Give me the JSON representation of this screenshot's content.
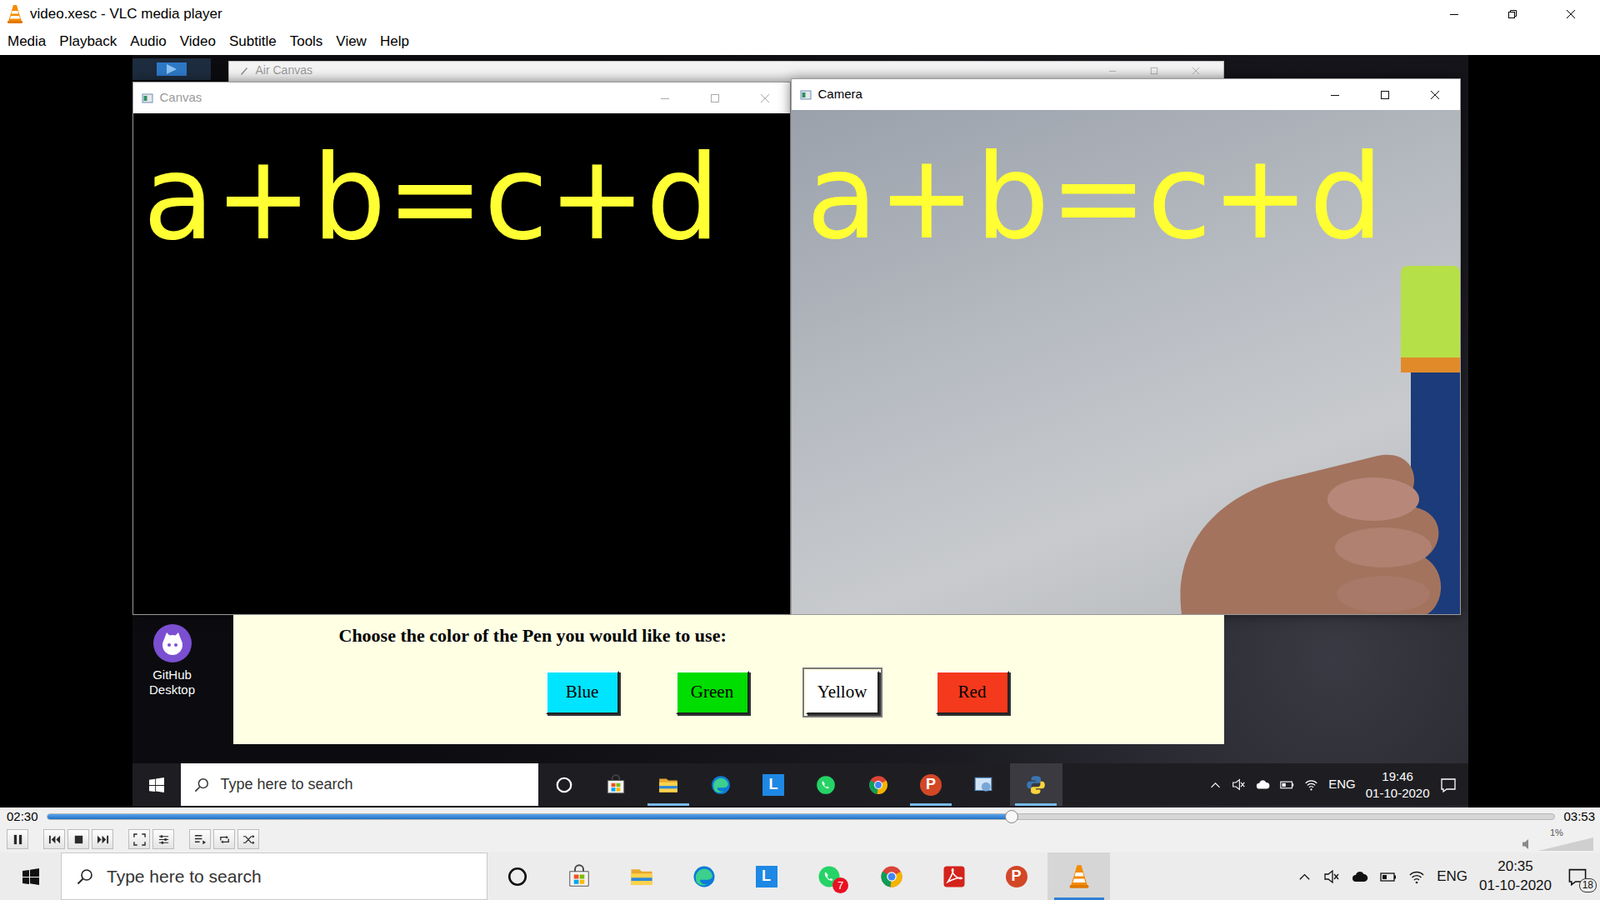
{
  "window": {
    "title": "video.xesc - VLC media player"
  },
  "menu": [
    {
      "label": "Media"
    },
    {
      "label": "Playback"
    },
    {
      "label": "Audio"
    },
    {
      "label": "Video"
    },
    {
      "label": "Subtitle"
    },
    {
      "label": "Tools"
    },
    {
      "label": "View"
    },
    {
      "label": "Help"
    }
  ],
  "video": {
    "back_window": {
      "title": "Air Canvas"
    },
    "canvas_window": {
      "title": "Canvas",
      "active": false,
      "drawing": "a+b=c+d"
    },
    "camera_window": {
      "title": "Camera",
      "active": true,
      "overlay": "a+b=c+d"
    },
    "pen_panel": {
      "prompt": "Choose the color of the Pen you would like to use:",
      "buttons": [
        {
          "label": "Blue",
          "color": "#00e5ff",
          "selected": false
        },
        {
          "label": "Green",
          "color": "#00dd00",
          "selected": false
        },
        {
          "label": "Yellow",
          "color": "#ffffff",
          "selected": true
        },
        {
          "label": "Red",
          "color": "#f5391c",
          "selected": false
        }
      ]
    },
    "desktop_icons": [
      {
        "label": "GitHub Desktop"
      }
    ],
    "taskbar": {
      "search_placeholder": "Type here to search",
      "apps": [
        {
          "active": false,
          "open": false
        },
        {
          "active": false,
          "open": true
        },
        {
          "active": false,
          "open": false
        },
        {
          "active": false,
          "open": false,
          "glyph": "L"
        },
        {
          "active": false,
          "open": false
        },
        {
          "active": false,
          "open": false
        },
        {
          "active": false,
          "open": true,
          "glyph": "P"
        },
        {
          "active": false,
          "open": false
        },
        {
          "active": true,
          "open": true
        }
      ],
      "language": "ENG",
      "time": "19:46",
      "date": "01-10-2020"
    }
  },
  "player": {
    "elapsed": "02:30",
    "total": "03:53",
    "level": 0.64,
    "playing": true,
    "volume": "1%",
    "volume_level": 0.01
  },
  "taskbar": {
    "search_placeholder": "Type here to search",
    "apps": [
      {
        "active": false,
        "open": false
      },
      {
        "active": false,
        "open": false
      },
      {
        "active": false,
        "open": false
      },
      {
        "active": false,
        "open": false,
        "glyph": "L"
      },
      {
        "active": false,
        "open": false,
        "badge": "7"
      },
      {
        "active": false,
        "open": false
      },
      {
        "active": false,
        "open": false
      },
      {
        "active": false,
        "open": false,
        "glyph": "P"
      },
      {
        "active": true,
        "open": true
      }
    ],
    "language": "ENG",
    "time": "20:35",
    "date": "01-10-2020",
    "notifications": "18"
  }
}
